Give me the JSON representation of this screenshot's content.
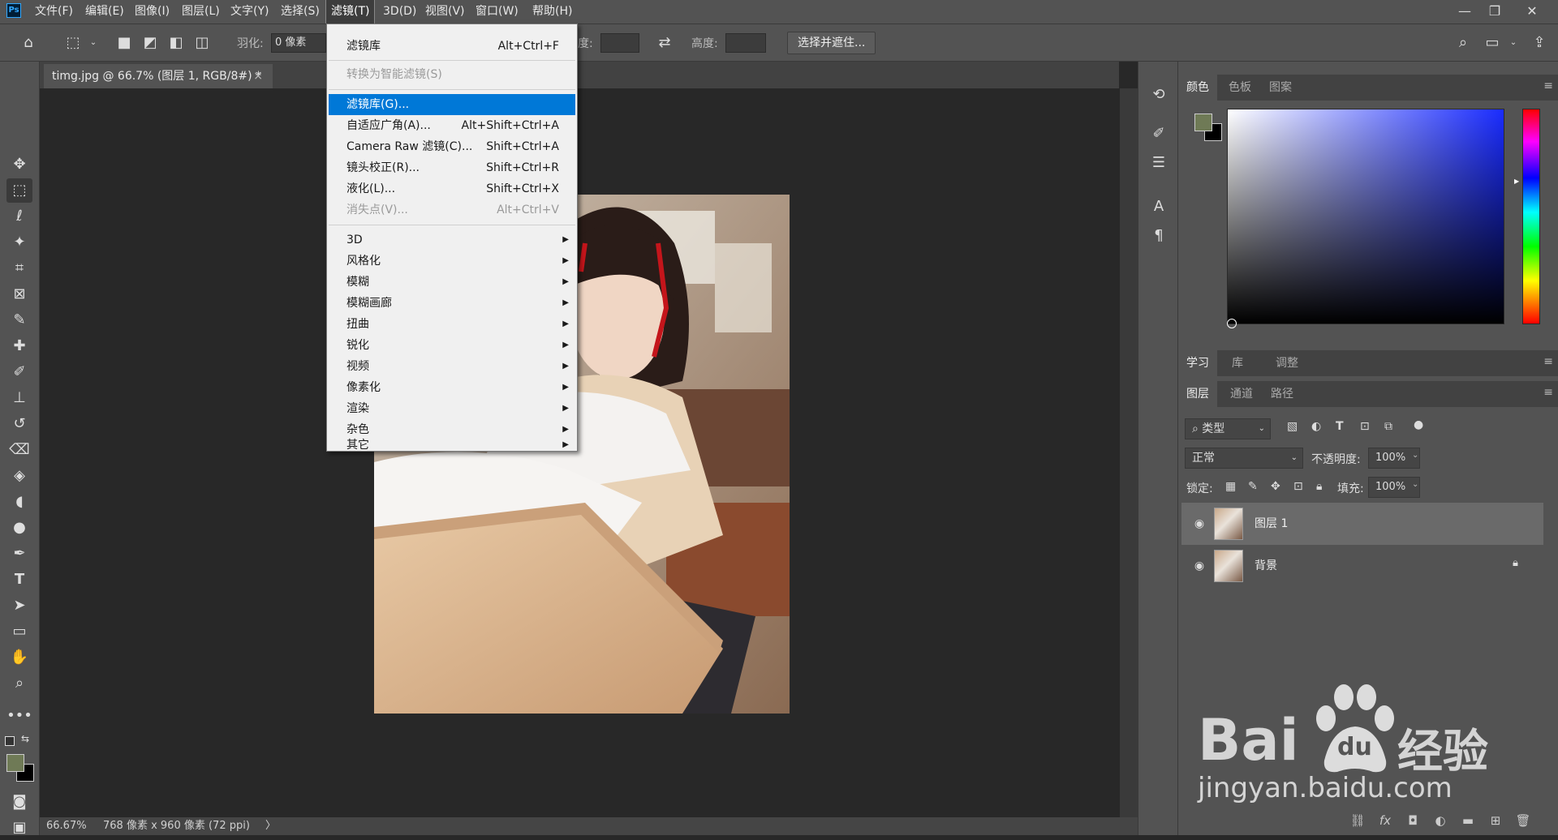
{
  "app": {
    "logo_text": "Ps"
  },
  "menubar": {
    "items": [
      "文件(F)",
      "编辑(E)",
      "图像(I)",
      "图层(L)",
      "文字(Y)",
      "选择(S)",
      "滤镜(T)",
      "3D(D)",
      "视图(V)",
      "窗口(W)",
      "帮助(H)"
    ],
    "active": "滤镜(T)"
  },
  "window_controls": {
    "minimize": "—",
    "restore": "❐",
    "close": "✕"
  },
  "options": {
    "feather_label": "羽化:",
    "feather_value": "0 像素",
    "width_label": "度:",
    "height_label": "高度:",
    "select_mask_button": "选择并遮住..."
  },
  "document": {
    "tab_title": "timg.jpg @ 66.7% (图层 1, RGB/8#) *",
    "tab_close": "×"
  },
  "status": {
    "zoom": "66.67%",
    "size": "768 像素 x 960 像素 (72 ppi)",
    "arrow": "〉"
  },
  "filter_menu": {
    "items": [
      {
        "label": "滤镜库",
        "shortcut": "Alt+Ctrl+F",
        "state": "normal"
      },
      {
        "label": "转换为智能滤镜(S)",
        "shortcut": "",
        "state": "disabled"
      },
      {
        "label": "滤镜库(G)...",
        "shortcut": "",
        "state": "highlighted"
      },
      {
        "label": "自适应广角(A)...",
        "shortcut": "Alt+Shift+Ctrl+A",
        "state": "normal"
      },
      {
        "label": "Camera Raw 滤镜(C)...",
        "shortcut": "Shift+Ctrl+A",
        "state": "normal"
      },
      {
        "label": "镜头校正(R)...",
        "shortcut": "Shift+Ctrl+R",
        "state": "normal"
      },
      {
        "label": "液化(L)...",
        "shortcut": "Shift+Ctrl+X",
        "state": "normal"
      },
      {
        "label": "消失点(V)...",
        "shortcut": "Alt+Ctrl+V",
        "state": "disabled"
      },
      {
        "label": "3D",
        "submenu": true
      },
      {
        "label": "风格化",
        "submenu": true
      },
      {
        "label": "模糊",
        "submenu": true
      },
      {
        "label": "模糊画廊",
        "submenu": true
      },
      {
        "label": "扭曲",
        "submenu": true
      },
      {
        "label": "锐化",
        "submenu": true
      },
      {
        "label": "视频",
        "submenu": true
      },
      {
        "label": "像素化",
        "submenu": true
      },
      {
        "label": "渲染",
        "submenu": true
      },
      {
        "label": "杂色",
        "submenu": true
      },
      {
        "label": "其它",
        "submenu": true
      }
    ]
  },
  "color_panel": {
    "tabs": [
      "颜色",
      "色板",
      "图案"
    ],
    "foreground": "#6f7a56",
    "background": "#000000"
  },
  "learn_panel": {
    "tabs": [
      "学习",
      "库",
      "调整"
    ]
  },
  "layers_panel": {
    "tabs": [
      "图层",
      "通道",
      "路径"
    ],
    "filter_kind": "类型",
    "blend_mode": "正常",
    "opacity_label": "不透明度:",
    "opacity_value": "100%",
    "lock_label": "锁定:",
    "fill_label": "填充:",
    "fill_value": "100%",
    "layers": [
      {
        "name": "图层 1",
        "selected": true,
        "locked": false
      },
      {
        "name": "背景",
        "selected": false,
        "locked": true
      }
    ]
  },
  "watermark": {
    "brand": "Bai",
    "brand_du": "du",
    "brand_cn": "经验",
    "url": "jingyan.baidu.com"
  },
  "colors": {
    "menu_highlight": "#0078d7",
    "panel_bg": "#535353",
    "canvas_bg": "#282828"
  }
}
